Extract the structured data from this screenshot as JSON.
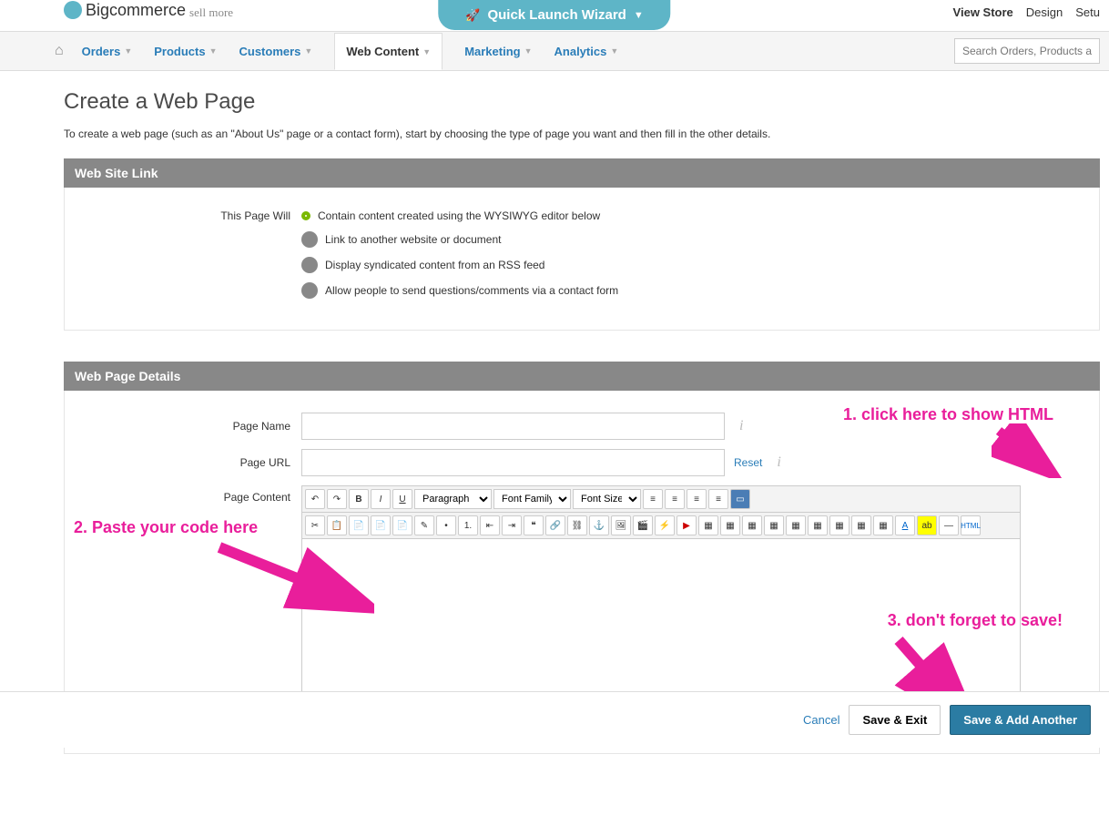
{
  "header": {
    "brand": "Bigcommerce",
    "tagline": "sell more",
    "wizard": "Quick Launch Wizard",
    "links": [
      "View Store",
      "Design",
      "Setu"
    ]
  },
  "nav": {
    "items": [
      "Orders",
      "Products",
      "Customers",
      "Web Content",
      "Marketing",
      "Analytics"
    ],
    "active_index": 3,
    "search_placeholder": "Search Orders, Products and Cu"
  },
  "page": {
    "title": "Create a Web Page",
    "intro": "To create a web page (such as an \"About Us\" page or a contact form), start by choosing the type of page you want and then fill in the other details."
  },
  "section1": {
    "title": "Web Site Link",
    "radio_label": "This Page Will",
    "options": [
      "Contain content created using the WYSIWYG editor below",
      "Link to another website or document",
      "Display syndicated content from an RSS feed",
      "Allow people to send questions/comments via a contact form"
    ],
    "selected": 0
  },
  "section2": {
    "title": "Web Page Details",
    "labels": {
      "name": "Page Name",
      "url": "Page URL",
      "content": "Page Content"
    },
    "reset": "Reset",
    "fields": {
      "name": "",
      "url": ""
    },
    "toolbar": {
      "paragraph": "Paragraph",
      "font_family": "Font Family",
      "font_size": "Font Size",
      "html": "HTML"
    }
  },
  "annotations": {
    "a1": "1. click here to show HTML",
    "a2": "2. Paste your code here",
    "a3": "3. don't forget to save!"
  },
  "footer": {
    "cancel": "Cancel",
    "save_exit": "Save & Exit",
    "save_add": "Save & Add Another"
  }
}
